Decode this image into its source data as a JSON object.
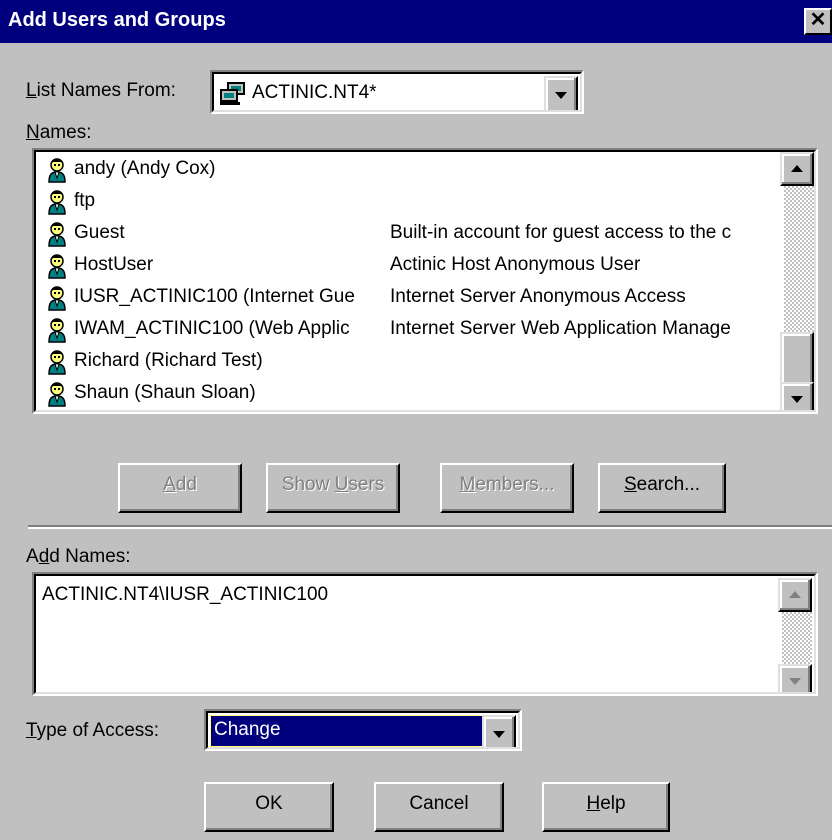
{
  "window": {
    "title": "Add Users and Groups",
    "close_label": "✕"
  },
  "list_names_from": {
    "label_prefix": "",
    "label_mnemonic": "L",
    "label_rest": "ist Names From:",
    "value": "ACTINIC.NT4*"
  },
  "names": {
    "label_mnemonic": "N",
    "label_rest": "ames:",
    "items": [
      {
        "name": "andy (Andy Cox)",
        "description": ""
      },
      {
        "name": "ftp",
        "description": ""
      },
      {
        "name": "Guest",
        "description": "Built-in account for guest access to the c"
      },
      {
        "name": "HostUser",
        "description": "Actinic Host Anonymous User"
      },
      {
        "name": "IUSR_ACTINIC100 (Internet Gue",
        "description": "Internet Server Anonymous Access"
      },
      {
        "name": "IWAM_ACTINIC100 (Web Applic",
        "description": "Internet Server Web Application Manage"
      },
      {
        "name": "Richard (Richard Test)",
        "description": ""
      },
      {
        "name": "Shaun (Shaun Sloan)",
        "description": ""
      }
    ]
  },
  "buttons": {
    "add": {
      "mnemonic": "A",
      "rest": "dd"
    },
    "show_users": {
      "pre": "Show ",
      "mnemonic": "U",
      "rest": "sers"
    },
    "members": {
      "mnemonic": "M",
      "rest": "embers..."
    },
    "search": {
      "mnemonic": "S",
      "rest": "earch..."
    },
    "ok": "OK",
    "cancel": "Cancel",
    "help": {
      "mnemonic": "H",
      "rest": "elp"
    }
  },
  "add_names": {
    "label_pre": "A",
    "label_mnemonic": "d",
    "label_rest": "d Names:",
    "value": "ACTINIC.NT4\\IUSR_ACTINIC100"
  },
  "type_of_access": {
    "label_mnemonic": "T",
    "label_rest": "ype of Access:",
    "value": "Change"
  },
  "colors": {
    "title_bar": "#00007f",
    "dialog": "#c0c0c0",
    "selection": "#00007f"
  }
}
